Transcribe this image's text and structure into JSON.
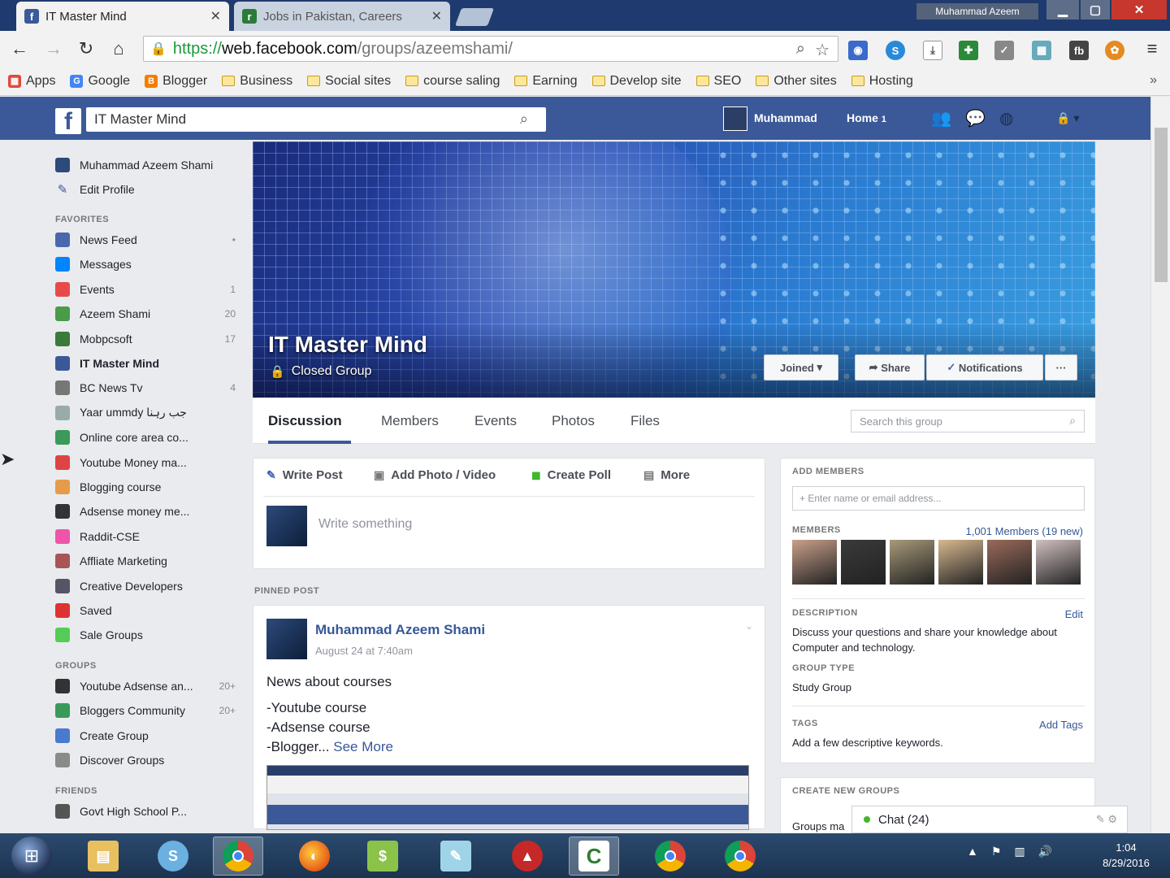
{
  "browser": {
    "tabs": [
      {
        "title": "IT Master Mind",
        "favicon": "facebook-icon",
        "active": true
      },
      {
        "title": "Jobs in Pakistan, Careers",
        "favicon": "rozee-icon",
        "active": false
      }
    ],
    "window_user": "Muhammad Azeem",
    "url": {
      "scheme": "https://",
      "host": "web.facebook.com",
      "path": "/groups/azeemshami/"
    },
    "bookmarks": [
      {
        "label": "Apps",
        "icon": "apps-grid-icon"
      },
      {
        "label": "Google",
        "icon": "google-icon"
      },
      {
        "label": "Blogger",
        "icon": "blogger-icon"
      },
      {
        "label": "Business",
        "icon": "folder-icon"
      },
      {
        "label": "Social sites",
        "icon": "folder-icon"
      },
      {
        "label": "course saling",
        "icon": "folder-icon"
      },
      {
        "label": "Earning",
        "icon": "folder-icon"
      },
      {
        "label": "Develop site",
        "icon": "folder-icon"
      },
      {
        "label": "SEO",
        "icon": "folder-icon"
      },
      {
        "label": "Other sites",
        "icon": "folder-icon"
      },
      {
        "label": "Hosting",
        "icon": "folder-icon"
      }
    ],
    "bookmarks_more": "»"
  },
  "facebook": {
    "search_value": "IT Master Mind",
    "user_name": "Muhammad",
    "home_label": "Home",
    "home_count": "1",
    "brand_color": "#3b5998"
  },
  "leftnav": {
    "profile_name": "Muhammad Azeem Shami",
    "edit_profile": "Edit Profile",
    "favorites_heading": "FAVORITES",
    "favorites": [
      {
        "label": "News Feed",
        "count": "•",
        "icon": "news-feed-icon",
        "color": "#4a66ad"
      },
      {
        "label": "Messages",
        "count": "",
        "icon": "messages-icon",
        "color": "#0084ff"
      },
      {
        "label": "Events",
        "count": "1",
        "icon": "events-icon",
        "color": "#e84a4a"
      },
      {
        "label": "Azeem Shami",
        "count": "20",
        "icon": "page-icon",
        "color": "#4a9b4a"
      },
      {
        "label": "Mobpcsoft",
        "count": "17",
        "icon": "page-icon",
        "color": "#3a7a3a"
      },
      {
        "label": "IT Master Mind",
        "count": "",
        "icon": "group-icon",
        "color": "#3b5998",
        "bold": true
      },
      {
        "label": "BC News Tv",
        "count": "4",
        "icon": "page-icon",
        "color": "#777"
      },
      {
        "label": "Yaar ummdy جب رہنا",
        "count": "",
        "icon": "page-icon",
        "color": "#9aa"
      },
      {
        "label": "Online core area co...",
        "count": "",
        "icon": "globe-icon",
        "color": "#3a9a5a"
      },
      {
        "label": "Youtube Money ma...",
        "count": "",
        "icon": "page-icon",
        "color": "#d44"
      },
      {
        "label": "Blogging course",
        "count": "",
        "icon": "page-icon",
        "color": "#e59b4a"
      },
      {
        "label": "Adsense money me...",
        "count": "",
        "icon": "soccer-icon",
        "color": "#333"
      },
      {
        "label": "Raddit-CSE",
        "count": "",
        "icon": "page-icon",
        "color": "#e5a"
      },
      {
        "label": "Affliate Marketing",
        "count": "",
        "icon": "page-icon",
        "color": "#a55"
      },
      {
        "label": "Creative Developers",
        "count": "",
        "icon": "code-icon",
        "color": "#556"
      },
      {
        "label": "Saved",
        "count": "",
        "icon": "saved-icon",
        "color": "#d33"
      },
      {
        "label": "Sale Groups",
        "count": "",
        "icon": "sale-groups-icon",
        "color": "#5c5"
      }
    ],
    "groups_heading": "GROUPS",
    "groups": [
      {
        "label": "Youtube Adsense an...",
        "count": "20+",
        "icon": "group-icon",
        "color": "#333"
      },
      {
        "label": "Bloggers Community",
        "count": "20+",
        "icon": "globe-icon",
        "color": "#3a9a5a"
      },
      {
        "label": "Create Group",
        "count": "",
        "icon": "create-group-icon",
        "color": "#4a7ad0"
      },
      {
        "label": "Discover Groups",
        "count": "",
        "icon": "discover-icon",
        "color": "#8a8a8a"
      }
    ],
    "friends_heading": "FRIENDS",
    "friends": [
      {
        "label": "Govt High School P...",
        "count": "",
        "icon": "school-icon",
        "color": "#555"
      }
    ]
  },
  "cover": {
    "title": "IT Master Mind",
    "subtitle": "Closed Group",
    "joined": "Joined",
    "share": "Share",
    "notifications": "Notifications",
    "more": "···"
  },
  "group_tabs": [
    "Discussion",
    "Members",
    "Events",
    "Photos",
    "Files"
  ],
  "group_search_placeholder": "Search this group",
  "composer": {
    "tabs": [
      {
        "label": "Write Post",
        "icon": "pencil-icon"
      },
      {
        "label": "Add Photo / Video",
        "icon": "camera-icon"
      },
      {
        "label": "Create Poll",
        "icon": "poll-icon"
      },
      {
        "label": "More",
        "icon": "more-icon"
      }
    ],
    "placeholder": "Write something"
  },
  "pinned_label": "PINNED POST",
  "post": {
    "author": "Muhammad Azeem Shami",
    "date": "August 24 at 7:40am",
    "heading": "News about courses",
    "lines": [
      "-Youtube course",
      "-Adsense course",
      "-Blogger..."
    ],
    "see_more": "See More"
  },
  "right": {
    "add_members_heading": "ADD MEMBERS",
    "add_members_placeholder": "+ Enter name or email address...",
    "members_heading": "MEMBERS",
    "members_link": "1,001 Members (19 new)",
    "member_thumbs": [
      "#c9a08a",
      "#3a3a3a",
      "#a89a7a",
      "#d8b890",
      "#9a6a5a",
      "#d0c0c0"
    ],
    "description_heading": "DESCRIPTION",
    "description_edit": "Edit",
    "description": "Discuss your questions and share your knowledge about Computer and technology.",
    "group_type_heading": "GROUP TYPE",
    "group_type": "Study Group",
    "tags_heading": "TAGS",
    "add_tags": "Add Tags",
    "tags_text": "Add a few descriptive keywords.",
    "create_heading": "CREATE NEW GROUPS",
    "create_text": "Groups ma"
  },
  "chat": {
    "label": "Chat (24)"
  },
  "taskbar": {
    "apps": [
      "file-explorer-icon",
      "skype-icon",
      "chrome-icon",
      "firefox-icon",
      "money-icon",
      "notepad-icon",
      "vlc-icon",
      "camtasia-icon",
      "chrome-icon",
      "chrome-icon"
    ],
    "clock_time": "1:04",
    "clock_date": "8/29/2016"
  }
}
